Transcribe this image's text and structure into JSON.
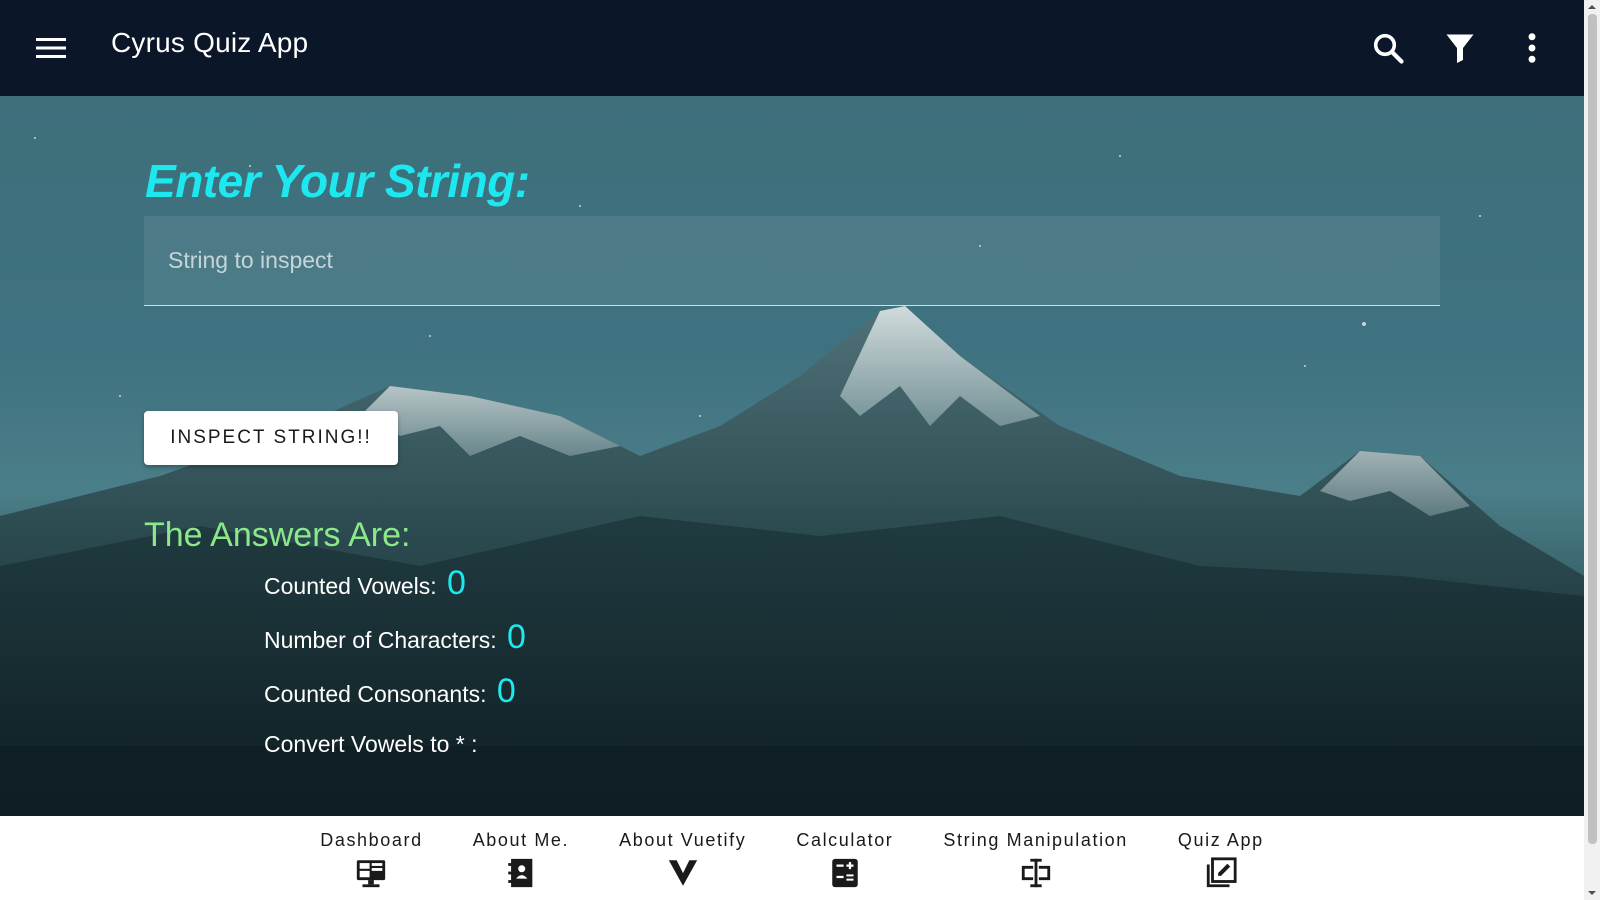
{
  "app_bar": {
    "title": "Cyrus Quiz App",
    "icons": [
      "menu-icon",
      "search-icon",
      "filter-icon",
      "more-vert-icon"
    ]
  },
  "form": {
    "heading": "Enter Your String:",
    "input_placeholder": "String to inspect",
    "input_value": "",
    "button_label": "INSPECT STRING!!"
  },
  "results": {
    "title": "The Answers Are:",
    "vowels_label": "Counted Vowels:",
    "vowels_value": "0",
    "chars_label": "Number of Characters:",
    "chars_value": "0",
    "consonants_label": "Counted Consonants:",
    "consonants_value": "0",
    "convert_label": "Convert Vowels to * :",
    "convert_value": ""
  },
  "bottom_nav": {
    "items": [
      {
        "label": "Dashboard",
        "icon": "monitor-dashboard-icon"
      },
      {
        "label": "About Me.",
        "icon": "contacts-book-icon"
      },
      {
        "label": "About Vuetify",
        "icon": "vuetify-icon"
      },
      {
        "label": "Calculator",
        "icon": "calculator-icon"
      },
      {
        "label": "String Manipulation",
        "icon": "form-textbox-icon"
      },
      {
        "label": "Quiz App",
        "icon": "edit-box-icon"
      }
    ]
  },
  "colors": {
    "app_bar": "#0b1628",
    "heading": "#1ee8ef",
    "answers_title": "#8be98a",
    "values": "#1ee8ef"
  }
}
